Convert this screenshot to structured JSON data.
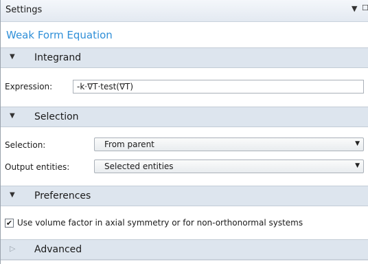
{
  "window": {
    "title": "Settings",
    "controls": {
      "menu_icon": "dropdown-triangle-icon",
      "restore_icon": "restore-window-icon"
    }
  },
  "page": {
    "title": "Weak Form Equation"
  },
  "sections": {
    "integrand": {
      "label": "Integrand",
      "expression_label": "Expression:",
      "expression_value": "-k·∇T·test(∇T)"
    },
    "selection": {
      "label": "Selection",
      "selection_label": "Selection:",
      "selection_value": "From parent",
      "output_label": "Output entities:",
      "output_value": "Selected entities"
    },
    "preferences": {
      "label": "Preferences",
      "checkbox_label": "Use volume factor in axial symmetry or for non-orthonormal systems",
      "checkbox_checked": true
    },
    "advanced": {
      "label": "Advanced",
      "collapsed": true
    }
  },
  "colors": {
    "accent": "#2f8fd8",
    "section_bg": "#dde5ee"
  }
}
